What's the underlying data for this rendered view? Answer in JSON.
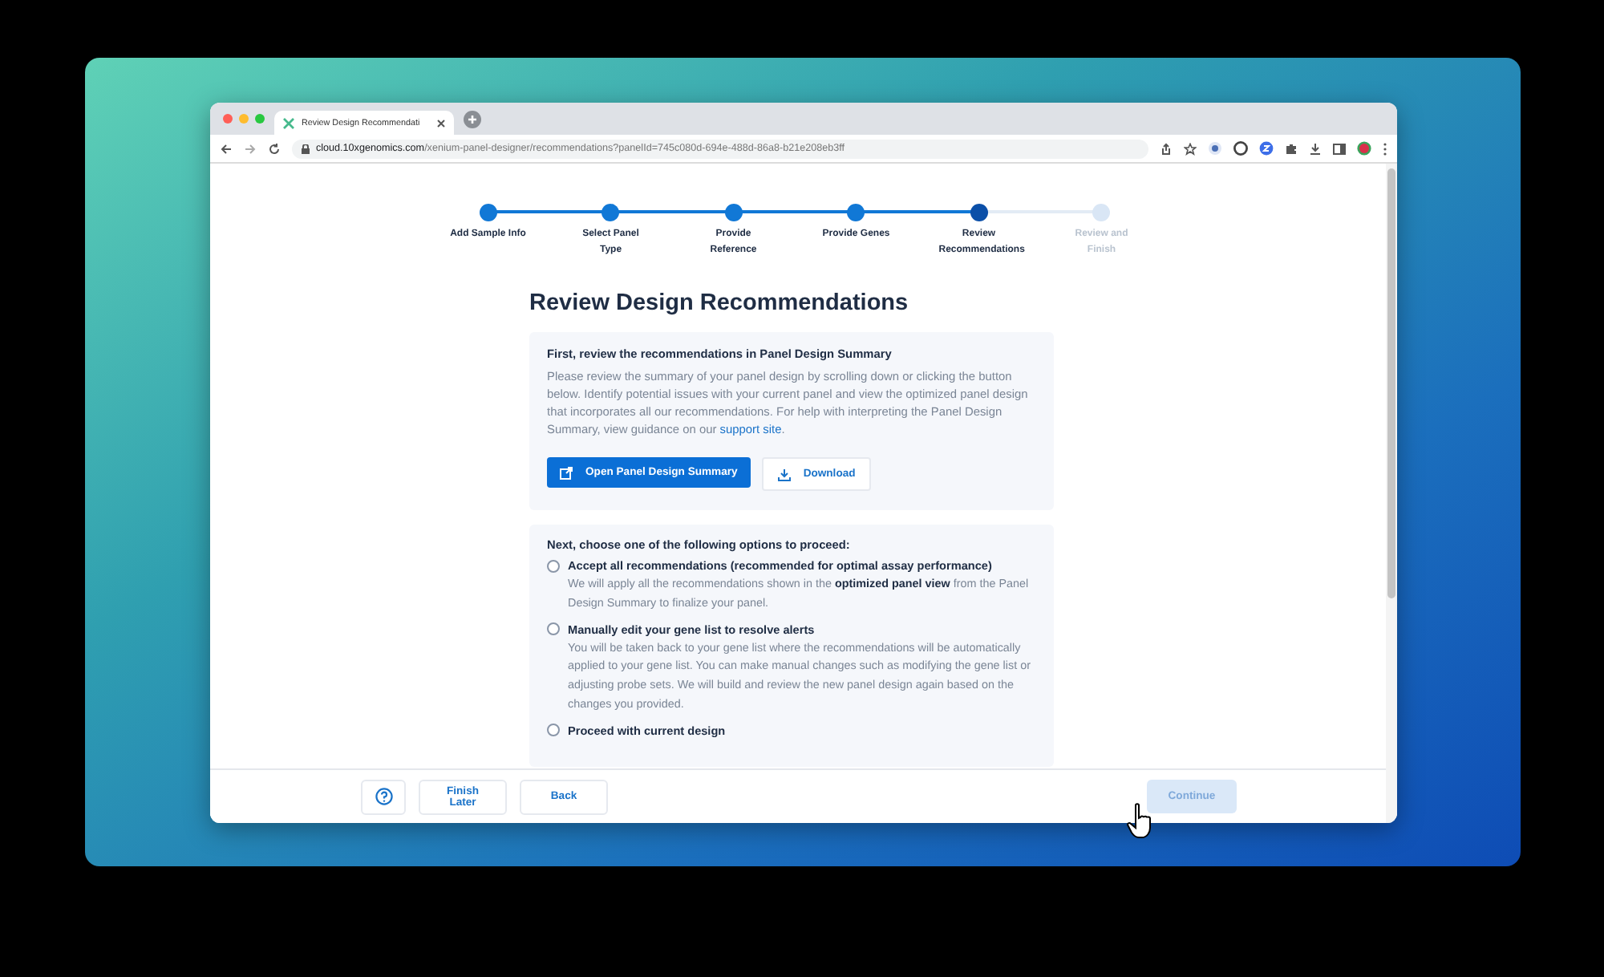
{
  "browser": {
    "tab_title": "Review Design Recommendati",
    "url_host": "cloud.10xgenomics.com",
    "url_path": "/xenium-panel-designer/recommendations?panelId=745c080d-694e-488d-86a8-b21e208eb3ff"
  },
  "steps": [
    {
      "label": "Add Sample Info",
      "completed": true,
      "selected": false
    },
    {
      "label": "Select Panel Type",
      "completed": true,
      "selected": false
    },
    {
      "label": "Provide Reference",
      "completed": true,
      "selected": false
    },
    {
      "label": "Provide Genes",
      "completed": true,
      "selected": false
    },
    {
      "label": "Review Recommendations",
      "completed": false,
      "selected": true
    },
    {
      "label": "Review and Finish",
      "completed": false,
      "selected": false
    }
  ],
  "title": "Review Design Recommendations",
  "summary_card": {
    "heading": "First, review the recommendations in Panel Design Summary",
    "text": "Please review the summary of your panel design by scrolling down or clicking the button below. Identify potential issues with your current panel and view the optimized panel design that incorporates all our recommendations. For help with interpreting the Panel Design Summary, view guidance on our",
    "link": "support site",
    "text_end": ".",
    "primary_button": "Open Panel Design Summary",
    "secondary_button": "Download"
  },
  "options_card": {
    "heading": "Next, choose one of the following options to proceed:",
    "options": [
      {
        "title": "Accept all recommendations (recommended for optimal assay performance)",
        "description": "We will apply all the recommendations shown in the **optimized panel view** from the Panel Design Summary to finalize your panel.",
        "selected": false
      },
      {
        "title": "Manually edit your gene list to resolve alerts",
        "description": "You will be taken back to your gene list where the recommendations will be automatically applied to your gene list. You can make manual changes such as modifying the gene list or adjusting probe sets. We will build and review the new panel design again based on the changes you provided.",
        "selected": false
      },
      {
        "title": "Proceed with current design",
        "selected": false
      }
    ]
  },
  "footer": {
    "buttons": [
      "Finish Later",
      "Back"
    ],
    "continue": {
      "label": "Continue",
      "disabled": true
    }
  }
}
